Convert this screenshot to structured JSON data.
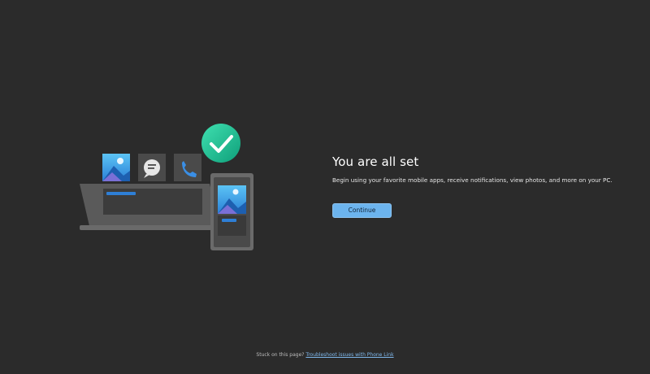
{
  "main": {
    "title": "You are all set",
    "subtitle": "Begin using your favorite mobile apps, receive notifications, view photos, and more on your PC.",
    "continue_label": "Continue"
  },
  "footer": {
    "prompt": "Stuck on this page?",
    "link_label": "Troubleshoot issues with Phone Link"
  },
  "colors": {
    "background": "#2b2b2b",
    "accent": "#6cb4ee",
    "success": "#1fbf8f",
    "link": "#7fb8ec"
  },
  "icons": [
    "checkmark-icon",
    "photo-icon",
    "chat-icon",
    "phone-call-icon"
  ]
}
